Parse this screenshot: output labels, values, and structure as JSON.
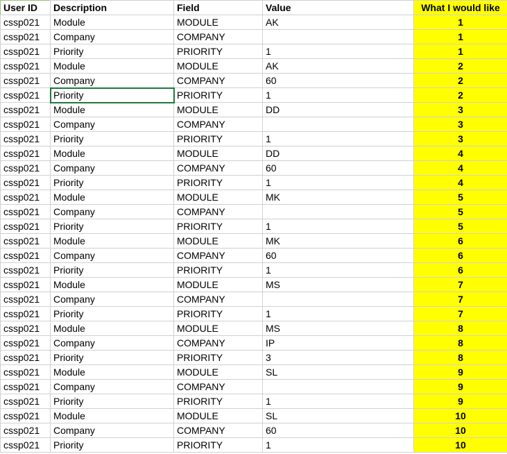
{
  "headers": {
    "user_id": "User ID",
    "description": "Description",
    "field": "Field",
    "value": "Value",
    "what": "What I would like"
  },
  "selected": {
    "row": 5,
    "col": 1
  },
  "rows": [
    {
      "user_id": "cssp021",
      "description": "Module",
      "field": "MODULE",
      "value": "AK",
      "what": "1"
    },
    {
      "user_id": "cssp021",
      "description": "Company",
      "field": "COMPANY",
      "value": "",
      "what": "1"
    },
    {
      "user_id": "cssp021",
      "description": "Priority",
      "field": "PRIORITY",
      "value": "1",
      "what": "1"
    },
    {
      "user_id": "cssp021",
      "description": "Module",
      "field": "MODULE",
      "value": "AK",
      "what": "2"
    },
    {
      "user_id": "cssp021",
      "description": "Company",
      "field": "COMPANY",
      "value": "60",
      "what": "2"
    },
    {
      "user_id": "cssp021",
      "description": "Priority",
      "field": "PRIORITY",
      "value": "1",
      "what": "2"
    },
    {
      "user_id": "cssp021",
      "description": "Module",
      "field": "MODULE",
      "value": "DD",
      "what": "3"
    },
    {
      "user_id": "cssp021",
      "description": "Company",
      "field": "COMPANY",
      "value": "",
      "what": "3"
    },
    {
      "user_id": "cssp021",
      "description": "Priority",
      "field": "PRIORITY",
      "value": "1",
      "what": "3"
    },
    {
      "user_id": "cssp021",
      "description": "Module",
      "field": "MODULE",
      "value": "DD",
      "what": "4"
    },
    {
      "user_id": "cssp021",
      "description": "Company",
      "field": "COMPANY",
      "value": "60",
      "what": "4"
    },
    {
      "user_id": "cssp021",
      "description": "Priority",
      "field": "PRIORITY",
      "value": "1",
      "what": "4"
    },
    {
      "user_id": "cssp021",
      "description": "Module",
      "field": "MODULE",
      "value": "MK",
      "what": "5"
    },
    {
      "user_id": "cssp021",
      "description": "Company",
      "field": "COMPANY",
      "value": "",
      "what": "5"
    },
    {
      "user_id": "cssp021",
      "description": "Priority",
      "field": "PRIORITY",
      "value": "1",
      "what": "5"
    },
    {
      "user_id": "cssp021",
      "description": "Module",
      "field": "MODULE",
      "value": "MK",
      "what": "6"
    },
    {
      "user_id": "cssp021",
      "description": "Company",
      "field": "COMPANY",
      "value": "60",
      "what": "6"
    },
    {
      "user_id": "cssp021",
      "description": "Priority",
      "field": "PRIORITY",
      "value": "1",
      "what": "6"
    },
    {
      "user_id": "cssp021",
      "description": "Module",
      "field": "MODULE",
      "value": "MS",
      "what": "7"
    },
    {
      "user_id": "cssp021",
      "description": "Company",
      "field": "COMPANY",
      "value": "",
      "what": "7"
    },
    {
      "user_id": "cssp021",
      "description": "Priority",
      "field": "PRIORITY",
      "value": "1",
      "what": "7"
    },
    {
      "user_id": "cssp021",
      "description": "Module",
      "field": "MODULE",
      "value": "MS",
      "what": "8"
    },
    {
      "user_id": "cssp021",
      "description": "Company",
      "field": "COMPANY",
      "value": "IP",
      "what": "8"
    },
    {
      "user_id": "cssp021",
      "description": "Priority",
      "field": "PRIORITY",
      "value": "3",
      "what": "8"
    },
    {
      "user_id": "cssp021",
      "description": "Module",
      "field": "MODULE",
      "value": "SL",
      "what": "9"
    },
    {
      "user_id": "cssp021",
      "description": "Company",
      "field": "COMPANY",
      "value": "",
      "what": "9"
    },
    {
      "user_id": "cssp021",
      "description": "Priority",
      "field": "PRIORITY",
      "value": "1",
      "what": "9"
    },
    {
      "user_id": "cssp021",
      "description": "Module",
      "field": "MODULE",
      "value": "SL",
      "what": "10"
    },
    {
      "user_id": "cssp021",
      "description": "Company",
      "field": "COMPANY",
      "value": "60",
      "what": "10"
    },
    {
      "user_id": "cssp021",
      "description": "Priority",
      "field": "PRIORITY",
      "value": "1",
      "what": "10"
    }
  ]
}
